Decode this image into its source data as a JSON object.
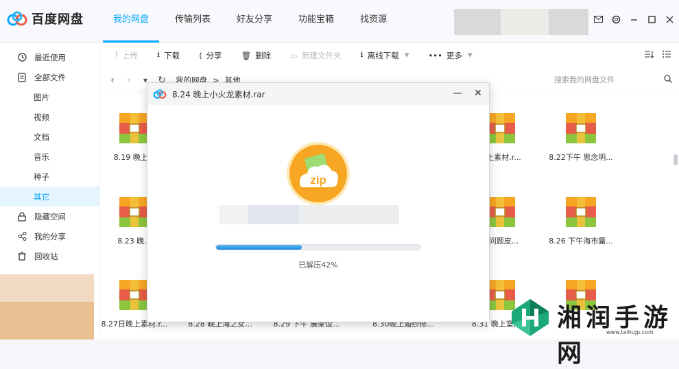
{
  "app": {
    "name": "百度网盘",
    "colors": {
      "accent": "#06a7ff",
      "zip": "#f6a623",
      "rar_red": "#e85c4a",
      "rar_green": "#8cc63e"
    }
  },
  "nav": {
    "tabs": [
      {
        "label": "我的网盘",
        "active": true
      },
      {
        "label": "传输列表"
      },
      {
        "label": "好友分享"
      },
      {
        "label": "功能宝箱"
      },
      {
        "label": "找资源"
      }
    ]
  },
  "sidebar": {
    "items": [
      {
        "label": "最近使用",
        "icon": "clock-icon"
      },
      {
        "label": "全部文件",
        "icon": "document-icon"
      },
      {
        "label": "图片"
      },
      {
        "label": "视频"
      },
      {
        "label": "文档"
      },
      {
        "label": "音乐"
      },
      {
        "label": "种子"
      },
      {
        "label": "其它",
        "active": true
      },
      {
        "label": "隐藏空间",
        "icon": "lock-icon"
      },
      {
        "label": "我的分享",
        "icon": "share-icon"
      },
      {
        "label": "回收站",
        "icon": "trash-icon"
      }
    ]
  },
  "toolbar": {
    "upload": "上传",
    "download": "下载",
    "share": "分享",
    "delete": "删除",
    "new_folder": "新建文件夹",
    "offline_download": "离线下载",
    "more": "更多"
  },
  "path": {
    "crumbs": [
      "我的网盘",
      "其他"
    ],
    "separator": ">",
    "search_placeholder": "搜索我的网盘文件"
  },
  "files": [
    {
      "name": "8.19 晚上..."
    },
    {
      "name": "晚上素材.r..."
    },
    {
      "name": "8.22下午 思念明..."
    },
    {
      "name": "8.23 晚..."
    },
    {
      "name": "上问题皮..."
    },
    {
      "name": "8.26 下午海市蜃..."
    },
    {
      "name": "8.27日晚上素材.r..."
    },
    {
      "name": "8.28 晚上海之女..."
    },
    {
      "name": "8.29 下午 展架设..."
    },
    {
      "name": "8.30晚上婚纱修..."
    },
    {
      "name": "8.31 晚上室内..."
    }
  ],
  "dialog": {
    "title": "8.24 晚上小火龙素材.rar",
    "icon_label": "zip",
    "progress_percent": 42,
    "status": "已解压42%"
  },
  "watermark": {
    "text": "湘润手游网",
    "url": "www.taihujp.com"
  }
}
